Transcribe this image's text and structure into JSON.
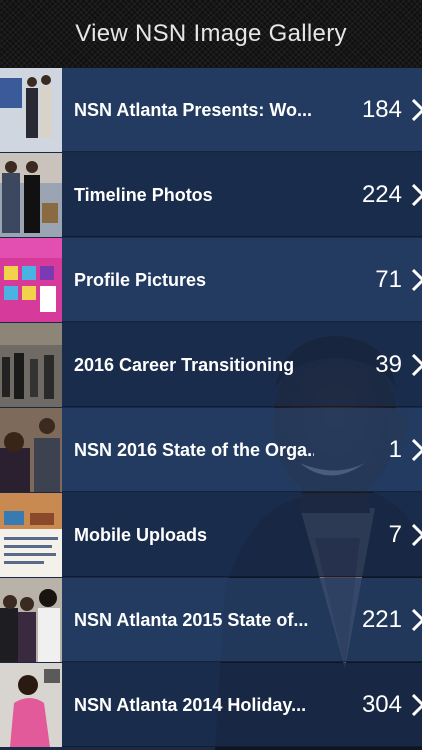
{
  "header": {
    "title": "View NSN Image Gallery"
  },
  "albums": [
    {
      "title": "NSN Atlanta Presents: Wo...",
      "count": "184"
    },
    {
      "title": "Timeline Photos",
      "count": "224"
    },
    {
      "title": "Profile Pictures",
      "count": "71"
    },
    {
      "title": "2016 Career Transitioning",
      "count": "39"
    },
    {
      "title": "NSN 2016 State of the Orga...",
      "count": "1"
    },
    {
      "title": "Mobile Uploads",
      "count": "7"
    },
    {
      "title": "NSN Atlanta 2015 State of...",
      "count": "221"
    },
    {
      "title": "NSN Atlanta 2014 Holiday...",
      "count": "304"
    }
  ],
  "icons": {
    "row_chevron": "chevron-right-icon"
  },
  "colors": {
    "header_bg": "#111111",
    "row_light": "#264068",
    "row_dark": "#1a2d4e",
    "text": "#ffffff"
  }
}
